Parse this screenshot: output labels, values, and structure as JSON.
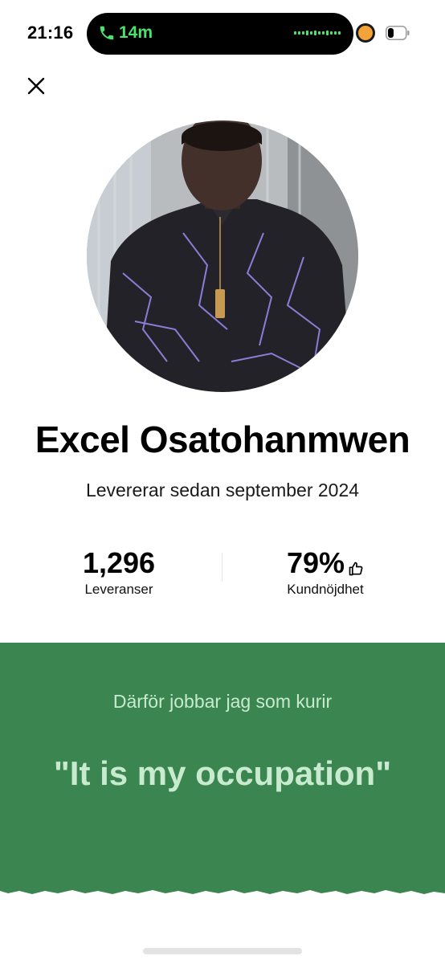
{
  "status_bar": {
    "time": "21:16",
    "call_duration": "14m",
    "icons": [
      "phone-icon",
      "waveform-icon",
      "camera-indicator",
      "battery-icon"
    ],
    "call_color": "#4be36b",
    "indicator_color": "#f2a43a"
  },
  "header": {
    "close_icon": "close-icon"
  },
  "profile": {
    "name": "Excel Osatohanmwen",
    "since": "Levererar sedan september 2024",
    "stats": [
      {
        "value": "1,296",
        "label": "Leveranser"
      },
      {
        "value": "79%",
        "label": "Kundnöjdhet",
        "icon": "thumbs-up-icon"
      }
    ]
  },
  "why_section": {
    "heading": "Därför jobbar jag som kurir",
    "quote": "\"It is my occupation\"",
    "background_color": "#3a8550",
    "text_color": "#c8ebcf"
  }
}
